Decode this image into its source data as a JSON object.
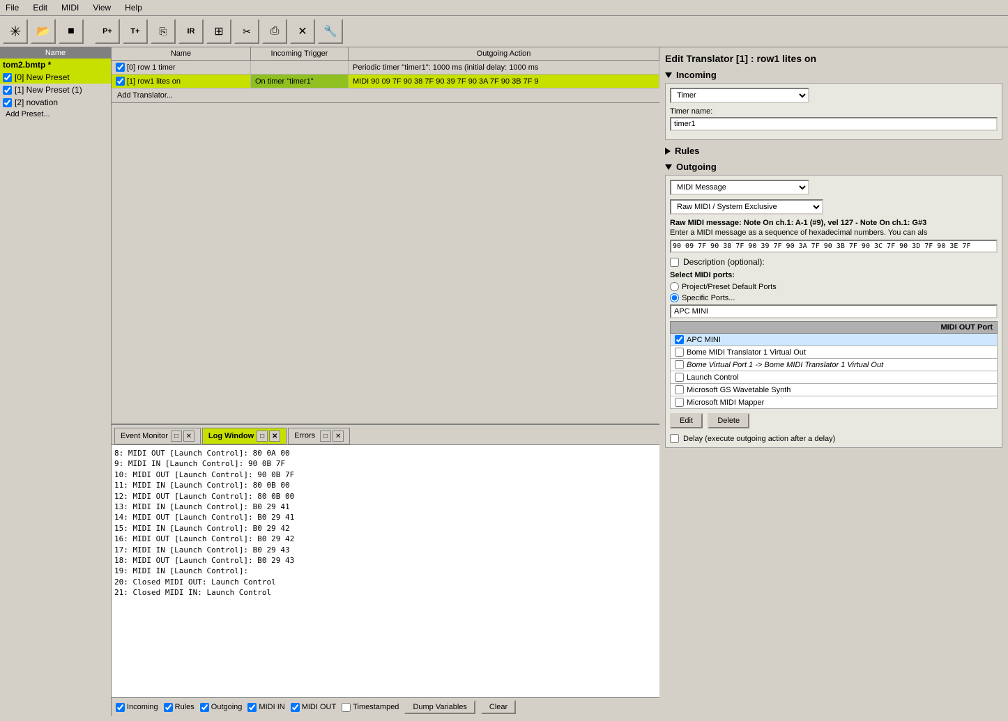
{
  "menu": {
    "items": [
      "File",
      "Edit",
      "MIDI",
      "View",
      "Help"
    ]
  },
  "toolbar": {
    "buttons": [
      {
        "name": "star-btn",
        "icon": "✳",
        "label": "New File"
      },
      {
        "name": "open-btn",
        "icon": "📂",
        "label": "Open"
      },
      {
        "name": "save-btn",
        "icon": "💾",
        "label": "Save"
      },
      {
        "name": "sep1",
        "icon": "",
        "label": ""
      },
      {
        "name": "add-preset-btn",
        "icon": "P+",
        "label": "Add Preset"
      },
      {
        "name": "add-translator-btn",
        "icon": "T+",
        "label": "Add Translator"
      },
      {
        "name": "copy-btn",
        "icon": "📋",
        "label": "Copy"
      },
      {
        "name": "ir-btn",
        "icon": "IR",
        "label": "IR"
      },
      {
        "name": "grid-btn",
        "icon": "⊞",
        "label": "Grid"
      },
      {
        "name": "cut-btn",
        "icon": "✂",
        "label": "Cut"
      },
      {
        "name": "paste-btn",
        "icon": "📌",
        "label": "Paste"
      },
      {
        "name": "close-btn",
        "icon": "✕",
        "label": "Close"
      },
      {
        "name": "tool-btn",
        "icon": "🔧",
        "label": "Tool"
      }
    ]
  },
  "left_panel": {
    "header": "Name",
    "file_name": "tom2.bmtp *",
    "presets": [
      {
        "id": 0,
        "label": "[0] New Preset",
        "checked": true,
        "selected": true
      },
      {
        "id": 1,
        "label": "[1] New Preset (1)",
        "checked": true,
        "selected": false
      },
      {
        "id": 2,
        "label": "[2] novation",
        "checked": true,
        "selected": false
      }
    ],
    "add_preset_label": "Add Preset..."
  },
  "translator_table": {
    "headers": [
      "Name",
      "Incoming Trigger",
      "Outgoing Action"
    ],
    "rows": [
      {
        "id": 0,
        "checked": true,
        "name": "[0] row 1 timer",
        "incoming": "",
        "outgoing": "Periodic timer \"timer1\": 1000 ms (initial delay: 1000 ms",
        "selected": false,
        "incoming_green": false
      },
      {
        "id": 1,
        "checked": true,
        "name": "[1] row1 lites on",
        "incoming": "On timer \"timer1\"",
        "outgoing": "MIDI 90 09 7F 90 38 7F 90 39 7F 90 3A 7F 90 3B 7F 9",
        "selected": true,
        "incoming_green": true
      }
    ],
    "add_translator_label": "Add Translator..."
  },
  "editor": {
    "title": "Edit Translator [1] : row1 lites on",
    "incoming_section": "Incoming",
    "incoming_type": "Timer",
    "timer_name_label": "Timer name:",
    "timer_name_value": "timer1",
    "rules_section": "Rules",
    "outgoing_section": "Outgoing",
    "outgoing_type": "MIDI Message",
    "outgoing_subtype": "Raw MIDI / System Exclusive",
    "raw_midi_label": "Raw MIDI message:",
    "raw_midi_desc": "Note On ch.1: A-1 (#9), vel 127 - Note On ch.1: G#3",
    "raw_midi_hint": "Enter a MIDI message as a sequence of hexadecimal numbers. You can als",
    "raw_midi_value": "90 09 7F 90 38 7F 90 39 7F 90 3A 7F 90 3B 7F 90 3C 7F 90 3D 7F 90 3E 7F",
    "description_label": "Description (optional):",
    "select_midi_ports": "Select MIDI ports:",
    "port_project_default": "Project/Preset Default Ports",
    "port_specific": "Specific Ports...",
    "port_input_value": "APC MINI",
    "midi_out_port_header": "MIDI OUT Port",
    "midi_ports": [
      {
        "label": "APC MINI",
        "checked": true,
        "italic": false
      },
      {
        "label": "Bome MIDI Translator 1 Virtual Out",
        "checked": false,
        "italic": false
      },
      {
        "label": "Bome Virtual Port 1 -> Bome MIDI Translator 1 Virtual Out",
        "checked": false,
        "italic": true
      },
      {
        "label": "Launch Control",
        "checked": false,
        "italic": false
      },
      {
        "label": "Microsoft GS Wavetable Synth",
        "checked": false,
        "italic": false
      },
      {
        "label": "Microsoft MIDI Mapper",
        "checked": false,
        "italic": false
      }
    ],
    "edit_btn": "Edit",
    "delete_btn": "Delete",
    "delay_label": "Delay (execute outgoing action after a delay)"
  },
  "bottom_panel": {
    "tabs": [
      {
        "label": "Event Monitor",
        "active": false
      },
      {
        "label": "Log Window",
        "active": true
      },
      {
        "label": "Errors",
        "active": false
      }
    ],
    "log_lines": [
      "8: MIDI OUT [Launch Control]: 80 0A 00",
      "9: MIDI IN [Launch Control]: 90 0B 7F",
      "10: MIDI OUT [Launch Control]: 90 0B 7F",
      "11: MIDI IN [Launch Control]: 80 0B 00",
      "12: MIDI OUT [Launch Control]: 80 0B 00",
      "13: MIDI IN [Launch Control]: B0 29 41",
      "14: MIDI OUT [Launch Control]: B0 29 41",
      "15: MIDI IN [Launch Control]: B0 29 42",
      "16: MIDI OUT [Launch Control]: B0 29 42",
      "17: MIDI IN [Launch Control]: B0 29 43",
      "18: MIDI OUT [Launch Control]: B0 29 43",
      "19: MIDI IN [Launch Control]:",
      "20: Closed MIDI OUT: Launch Control",
      "21: Closed MIDI IN: Launch Control"
    ],
    "status_bar": {
      "checkboxes": [
        {
          "label": "Incoming",
          "checked": true
        },
        {
          "label": "Rules",
          "checked": true
        },
        {
          "label": "Outgoing",
          "checked": true
        },
        {
          "label": "MIDI IN",
          "checked": true
        },
        {
          "label": "MIDI OUT",
          "checked": true
        },
        {
          "label": "Timestamped",
          "checked": false
        }
      ],
      "dump_variables_btn": "Dump Variables",
      "clear_btn": "Clear"
    }
  }
}
